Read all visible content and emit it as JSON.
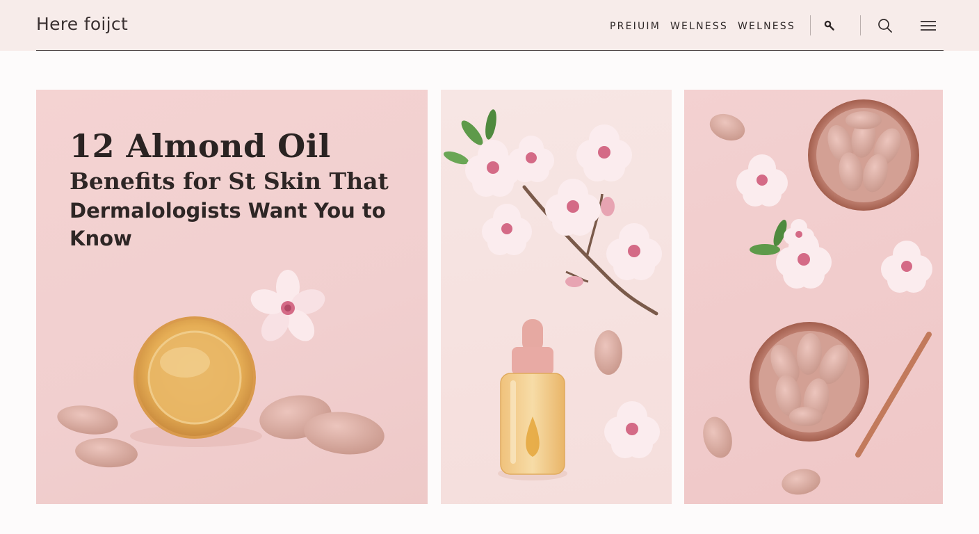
{
  "header": {
    "logo": "Here foijct",
    "nav": [
      "PREIUIM",
      "WELNESS",
      "WELNESS"
    ],
    "icons": [
      "tool-icon",
      "search-icon",
      "menu-icon"
    ]
  },
  "article": {
    "title_line1": "12 Almond Oil",
    "title_line2": "Benefits for St Skin That",
    "title_line3": "Dermalologists Want You to",
    "title_line4": "Know"
  },
  "colors": {
    "header_bg": "#f7ecea",
    "panel_pink": "#f2d0cf",
    "almond": "#dcaea3",
    "blossom": "#fbeaed",
    "oil": "#e9b35b"
  }
}
